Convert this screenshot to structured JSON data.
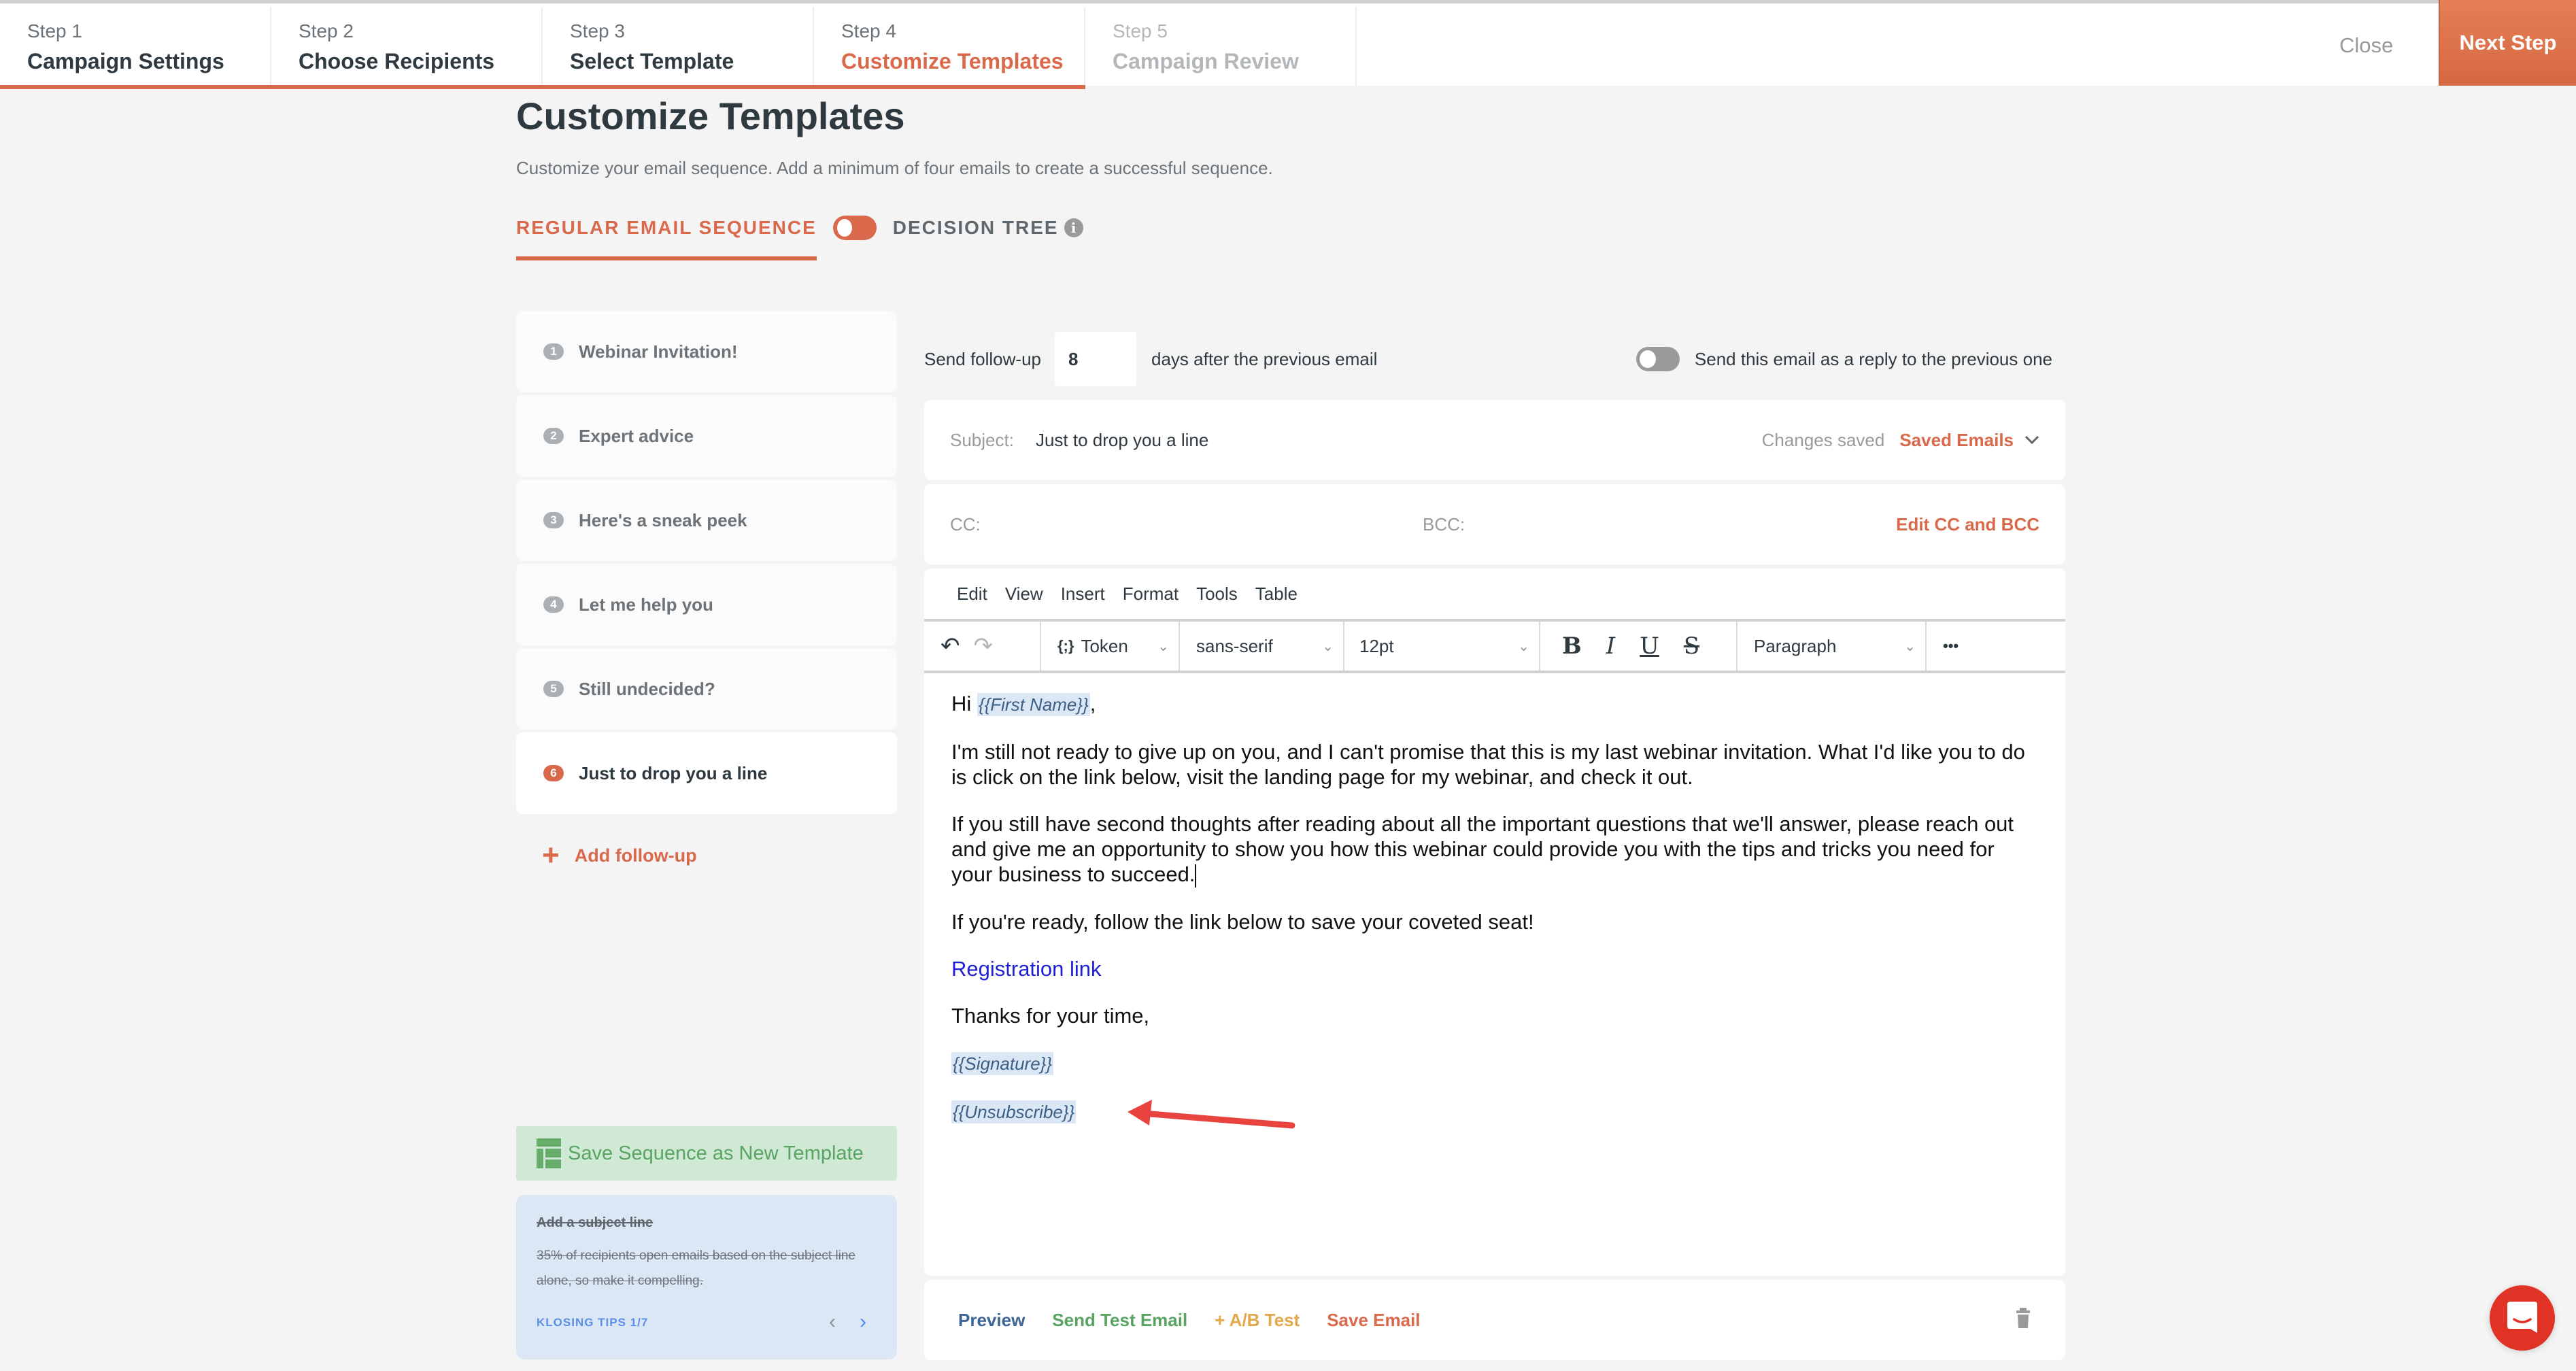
{
  "stepper": {
    "steps": [
      {
        "num": "Step 1",
        "label": "Campaign Settings",
        "state": "done"
      },
      {
        "num": "Step 2",
        "label": "Choose Recipients",
        "state": "done"
      },
      {
        "num": "Step 3",
        "label": "Select Template",
        "state": "done"
      },
      {
        "num": "Step 4",
        "label": "Customize Templates",
        "state": "active"
      },
      {
        "num": "Step 5",
        "label": "Campaign Review",
        "state": "future"
      }
    ],
    "close_label": "Close",
    "next_label": "Next Step"
  },
  "header": {
    "title": "Customize Templates",
    "subtitle": "Customize your email sequence. Add a minimum of four emails to create a successful sequence.",
    "mode_regular": "REGULAR EMAIL SEQUENCE",
    "mode_tree": "DECISION TREE",
    "info_glyph": "i"
  },
  "sequence": {
    "items": [
      {
        "num": "1",
        "name": "Webinar Invitation!"
      },
      {
        "num": "2",
        "name": "Expert advice"
      },
      {
        "num": "3",
        "name": "Here's a sneak peek"
      },
      {
        "num": "4",
        "name": "Let me help you"
      },
      {
        "num": "5",
        "name": "Still undecided?"
      },
      {
        "num": "6",
        "name": "Just to drop you a line",
        "active": true
      }
    ],
    "add_followup": "Add follow-up",
    "add_glyph": "+",
    "save_template": "Save Sequence as New Template"
  },
  "tips": {
    "title": "Add a subject line",
    "body": "35% of recipients open emails based on the subject line alone, so make it compelling.",
    "counter": "KLOSING TIPS 1/7",
    "prev_glyph": "‹",
    "next_glyph": "›"
  },
  "followup": {
    "prefix": "Send follow-up",
    "days": "8",
    "suffix": "days after the previous email",
    "reply_label": "Send this email as a reply to the previous one"
  },
  "subject": {
    "label": "Subject:",
    "value": "Just to drop you a line",
    "status": "Changes saved",
    "saved_emails": "Saved Emails",
    "chevron": "⌄"
  },
  "cc": {
    "cc_label": "CC:",
    "bcc_label": "BCC:",
    "edit_label": "Edit CC and BCC"
  },
  "editor": {
    "menu": [
      "Edit",
      "View",
      "Insert",
      "Format",
      "Tools",
      "Table"
    ],
    "toolbar": {
      "undo": "↶",
      "redo": "↷",
      "token_icon": "{;}",
      "token_label": "Token",
      "font_family": "sans-serif",
      "font_size": "12pt",
      "bold": "B",
      "italic": "I",
      "underline": "U",
      "strike": "S",
      "block": "Paragraph",
      "more": "•••",
      "chev": "⌄"
    },
    "body": {
      "greeting": "Hi",
      "first_name_token": "{{First Name}}",
      "greeting_end": ",",
      "p1": "I'm still not ready to give up on you, and I can't promise that this is my last webinar invitation. What I'd like you to do is click on the link below, visit the landing page for my webinar, and check it out.",
      "p2": "If you still have second thoughts after reading about all the important questions that we'll answer, please reach out and give me an opportunity to show you how this webinar could provide you with the tips and tricks you need for your business to succeed.",
      "p3": "If you're ready, follow the link below to save your coveted seat!",
      "link": "Registration link",
      "closing": "Thanks for your time,",
      "signature_token": "{{Signature}}",
      "unsubscribe_token": "{{Unsubscribe}}"
    }
  },
  "actions": {
    "preview": "Preview",
    "send_test": "Send Test Email",
    "ab_test": "+ A/B Test",
    "save_email": "Save Email"
  },
  "colors": {
    "accent": "#d9694a",
    "preview": "#3a6595",
    "send_test": "#5aa463",
    "ab_test": "#e3a84a",
    "save_email": "#d9694a",
    "annotation_arrow": "#e8433f",
    "chat_fab": "#e03326"
  }
}
